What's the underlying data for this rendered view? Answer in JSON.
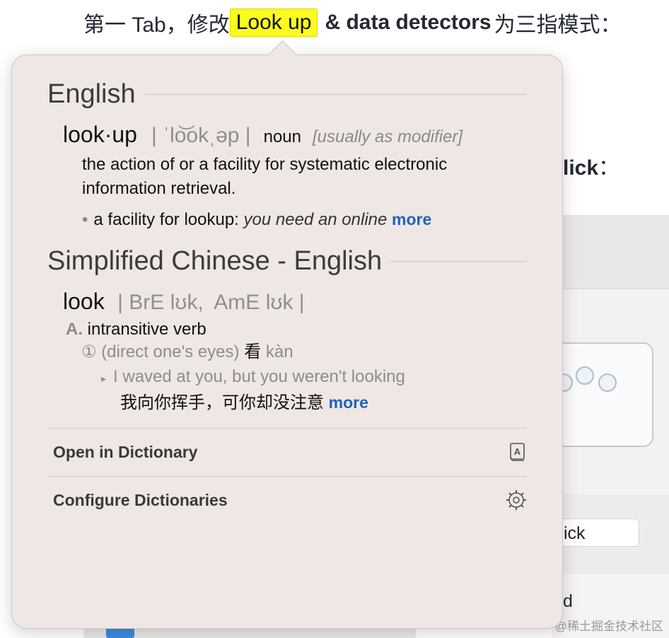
{
  "article": {
    "prefix": "第一 Tab，修改",
    "highlight": "Look up",
    "bold": "& data detectors",
    "suffix": "为三指模式：",
    "fragment_click": "lick",
    "fragment_colon": "：",
    "fragment_field": "ick",
    "fragment_d": "d"
  },
  "popover": {
    "sections": [
      {
        "title": "English",
        "headword": "look·up",
        "pronunciation": "| ˈlo͝okˌəp |",
        "part_of_speech": "noun",
        "usage_note": "[usually as modifier]",
        "definition": "the action of or a facility for systematic electronic information retrieval.",
        "example_lead": "a facility for lookup:",
        "example_text": "you need an online",
        "more_label": "more"
      },
      {
        "title": "Simplified Chinese - English",
        "headword": "look",
        "pronunciation_bre_label": "| BrE",
        "pronunciation_bre": "lʊk,",
        "pronunciation_ame_label": "AmE",
        "pronunciation_ame": "lʊk |",
        "sense_letter": "A.",
        "sense_pos": "intransitive verb",
        "sub_num": "①",
        "sub_gloss": "(direct one's eyes)",
        "sub_cn": "看",
        "sub_pinyin": "kàn",
        "example_en": "I waved at you, but you weren't looking",
        "example_cn": "我向你挥手，可你却没注意",
        "more_label": "more"
      }
    ],
    "actions": [
      {
        "label": "Open in Dictionary",
        "icon": "dictionary-book-icon"
      },
      {
        "label": "Configure Dictionaries",
        "icon": "gear-icon"
      }
    ]
  },
  "watermark": "@稀土掘金技术社区",
  "colors": {
    "highlight": "#fbfb1e",
    "popover_bg": "#efe7e3",
    "link": "#1e63c2"
  }
}
